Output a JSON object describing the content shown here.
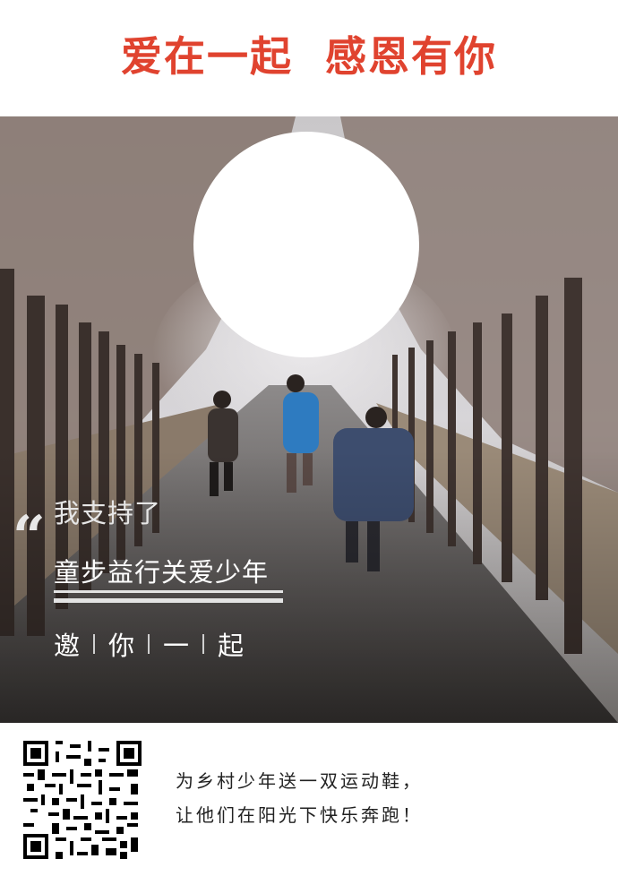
{
  "header": {
    "title_part1": "爱在一起",
    "title_part2": "感恩有你",
    "title_color": "#e0432f"
  },
  "poster": {
    "quote_mark": "“",
    "support_text": "我支持了",
    "project_name": "童步益行关爱少年",
    "invite_chars": [
      "邀",
      "你",
      "一",
      "起"
    ]
  },
  "footer": {
    "qr_icon": "qr-code-icon",
    "line1": "为乡村少年送一双运动鞋，",
    "line2": "让他们在阳光下快乐奔跑！"
  },
  "colors": {
    "accent": "#e0432f",
    "text_light": "#ffffff",
    "footer_text": "#222222"
  }
}
